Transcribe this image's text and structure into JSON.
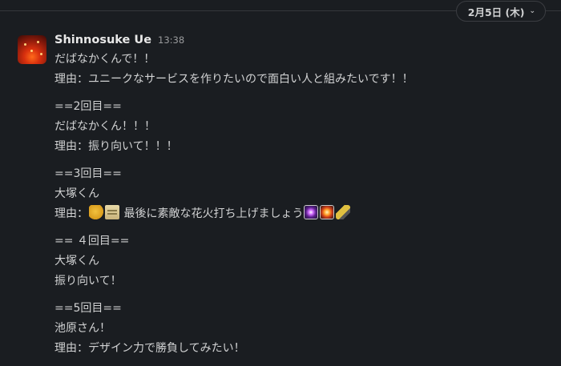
{
  "date_divider": {
    "label": "2月5日 (木)"
  },
  "message": {
    "author": "Shinnosuke Ue",
    "time": "13:38",
    "blocks": [
      {
        "lines": [
          "だばなかくんで！！",
          "理由：ユニークなサービスを作りたいので面白い人と組みたいです！！"
        ]
      },
      {
        "lines": [
          "==2回目==",
          "だばなかくん！！！",
          "理由：振り向いて！！！"
        ]
      },
      {
        "lines": [
          "==3回目==",
          "大塚くん"
        ],
        "reason_prefix": "理由：",
        "reason_text": "最後に素敵な花火打ち上げましょう",
        "emoji_before": [
          "fist-icon",
          "scroll-icon"
        ],
        "emoji_after": [
          "fireworks-icon",
          "firework-burst-icon",
          "rocket-icon"
        ]
      },
      {
        "lines": [
          "== ４回目==",
          "大塚くん",
          "振り向いて！"
        ]
      },
      {
        "lines": [
          "==5回目==",
          "池原さん！",
          "理由：デザイン力で勝負してみたい！"
        ]
      }
    ]
  }
}
